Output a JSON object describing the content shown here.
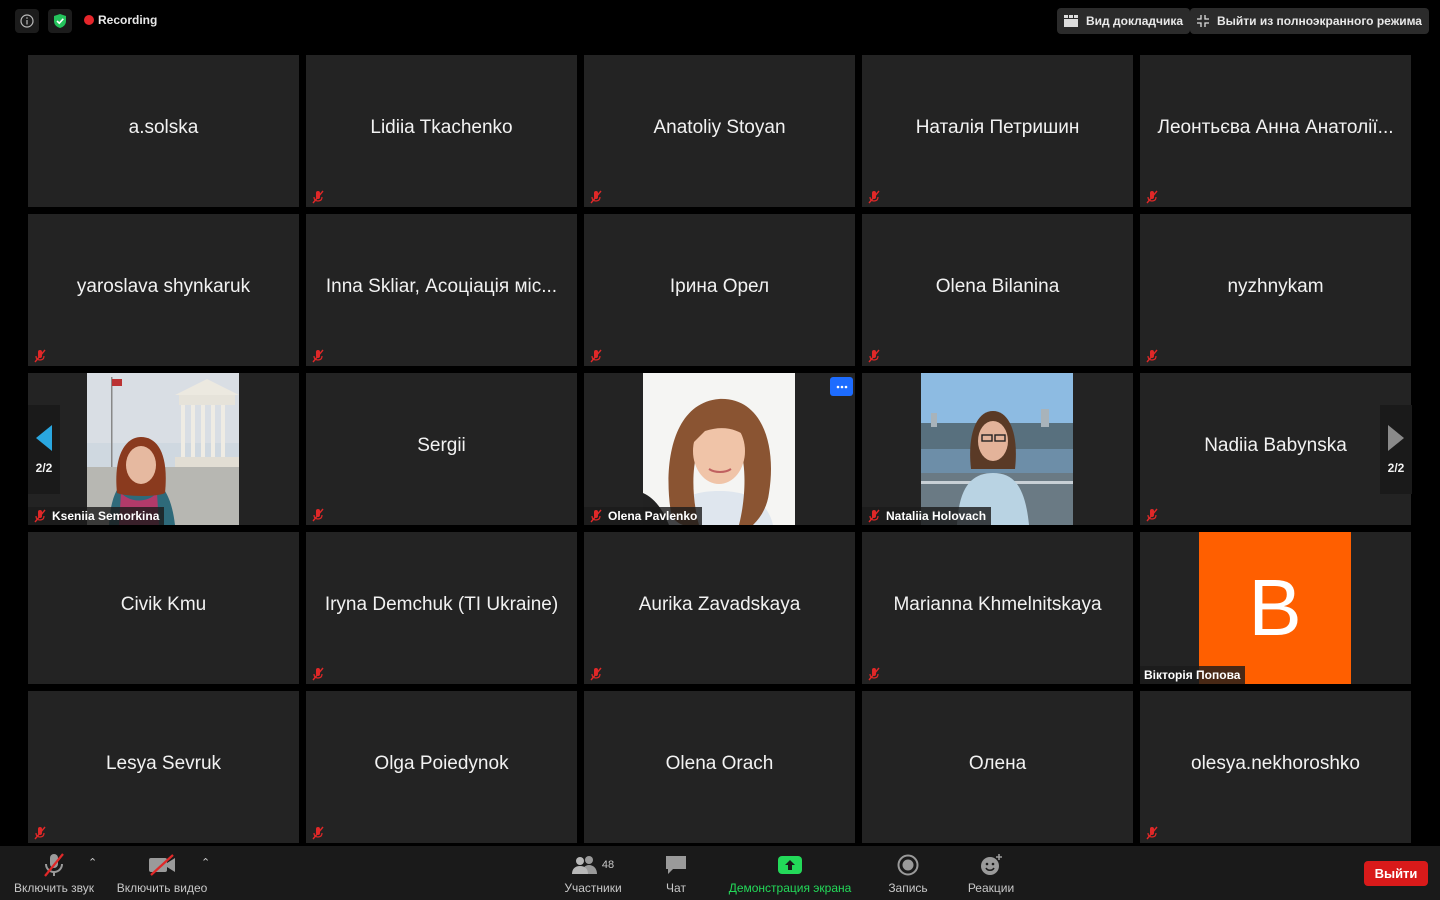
{
  "topbar": {
    "recording_label": "Recording",
    "speaker_view_label": "Вид докладчика",
    "exit_fullscreen_label": "Выйти из полноэкранного режима"
  },
  "pager": {
    "page_label": "2/2"
  },
  "tiles": [
    {
      "name": "a.solska",
      "muted": false
    },
    {
      "name": "Lidiia Tkachenko",
      "muted": true
    },
    {
      "name": "Anatoliy Stoyan",
      "muted": true
    },
    {
      "name": "Наталія Петришин",
      "muted": true
    },
    {
      "name": "Леонтьєва Анна Анатолії...",
      "muted": true
    },
    {
      "name": "yaroslava shynkaruk",
      "muted": true
    },
    {
      "name": "Inna Skliar,  Асоціація міс...",
      "muted": true
    },
    {
      "name": "Ірина Орел",
      "muted": true
    },
    {
      "name": "Olena Bilanina",
      "muted": true
    },
    {
      "name": "nyzhnykam",
      "muted": true
    },
    {
      "name": "Kseniia Semorkina",
      "muted": true,
      "video": "photo-capitol"
    },
    {
      "name": "Sergii",
      "muted": true
    },
    {
      "name": "Olena Pavlenko",
      "muted": true,
      "video": "photo-portrait"
    },
    {
      "name": "Nataliia Holovach",
      "muted": true,
      "video": "photo-city"
    },
    {
      "name": "Nadiia Babynska",
      "muted": true
    },
    {
      "name": "Civik Kmu",
      "muted": false
    },
    {
      "name": "Iryna Demchuk (TI Ukraine)",
      "muted": true
    },
    {
      "name": "Aurika Zavadskaya",
      "muted": true
    },
    {
      "name": "Marianna Khmelnitskaya",
      "muted": true
    },
    {
      "name": "Вікторія Попова",
      "muted": false,
      "avatar_letter": "B",
      "avatar_color": "#ff5f00"
    },
    {
      "name": "Lesya Sevruk",
      "muted": true
    },
    {
      "name": "Olga Poiedynok",
      "muted": true
    },
    {
      "name": "Olena Orach",
      "muted": false
    },
    {
      "name": "Олена",
      "muted": false
    },
    {
      "name": "olesya.nekhoroshko",
      "muted": true
    }
  ],
  "toolbar": {
    "unmute_label": "Включить звук",
    "start_video_label": "Включить видео",
    "participants_label": "Участники",
    "participants_count": "48",
    "chat_label": "Чат",
    "share_screen_label": "Демонстрация экрана",
    "record_label": "Запись",
    "reactions_label": "Реакции",
    "leave_label": "Выйти"
  },
  "colors": {
    "share_green": "#23d959",
    "leave_red": "#d91a1a",
    "mic_red": "#e02828",
    "accent_blue": "#1d6cff",
    "pager_blue": "#2aa7e0"
  }
}
